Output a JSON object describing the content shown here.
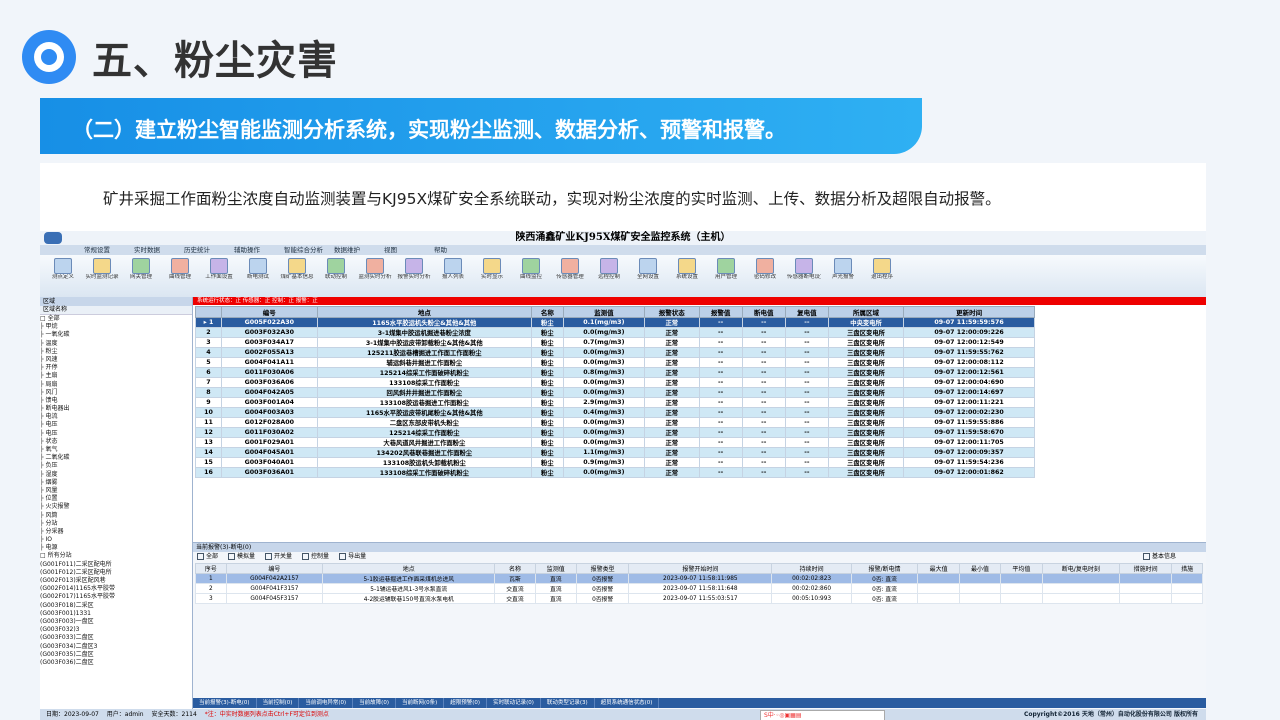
{
  "slide": {
    "title": "五、粉尘灾害",
    "banner": "（二）建立粉尘智能监测分析系统，实现粉尘监测、数据分析、预警和报警。",
    "intro": "矿井采掘工作面粉尘浓度自动监测装置与KJ95X煤矿安全系统联动，实现对粉尘浓度的实时监测、上传、数据分析及超限自动报警。"
  },
  "app": {
    "title": "陕西涌鑫矿业KJ95X煤矿安全监控系统（主机）",
    "menu": [
      "常规设置",
      "实时数据",
      "历史统计",
      "辅助操作",
      "智能综合分析",
      "数据维护",
      "视图",
      "帮助"
    ],
    "ribbon": [
      "测点定义",
      "实时监测记录",
      "网关管理",
      "曲线管理",
      "工作面设置",
      "断电测试",
      "煤矿基本信息",
      "联动控制",
      "监测实时分析",
      "报警实时分析",
      "报人列表",
      "实时显示",
      "曲线监控",
      "传感器管理",
      "远程控制",
      "全网设置",
      "系统设置",
      "用户管理",
      "密码修改",
      "传感器断电设置",
      "声光报警",
      "退出程序"
    ],
    "left_head": "区域",
    "left_subhead": "区域名称",
    "tree": [
      "□ 全部",
      "├ 甲烷",
      "├ 一氧化碳",
      "├ 温度",
      "├ 粉尘",
      "├ 风速",
      "├ 开停",
      "├ 主扇",
      "├ 局扇",
      "├ 风门",
      "├ 馈电",
      "├ 断电器出",
      "├ 电流",
      "├ 电压",
      "├ 电压",
      "├ 状态",
      "├ 氧气",
      "├ 二氧化碳",
      "├ 负压",
      "├ 湿度",
      "├ 烟雾",
      "├ 风量",
      "├ 位置",
      "├ 火灾报警",
      "├ 风筒",
      "├ 分站",
      "├ 分采器",
      "├ IO",
      "├ 电源",
      "□ 所有分站",
      "  (G001F011)二采区配电所",
      "  (G001F012)二采区配电所",
      "  (G002F013)采区配风巷",
      "  (G002F014)1165水平胶带",
      "  (G002F017)1165水平胶带",
      "  (G003F018)二采区",
      "  (G003F001)1331",
      "  (G003F003)一盘区",
      "  (G003F032)3",
      "  (G003F033)二盘区",
      "  (G003F034)二盘区3",
      "  (G003F035)二盘区",
      "  (G003F036)二盘区"
    ],
    "red_bar": "系统运行状态：正   传感器：正   控制：正   报警：正",
    "grid_headers": [
      "",
      "编号",
      "地点",
      "名称",
      "监测值",
      "报警状态",
      "报警值",
      "断电值",
      "复电值",
      "所属区域",
      "更新时间"
    ],
    "grid_rows": [
      [
        "1",
        "G005F022A30",
        "1165水平胶运机头粉尘&其他&其他",
        "粉尘",
        "0.1(mg/m3)",
        "正常",
        "--",
        "--",
        "--",
        "中央变电所",
        "09-07 11:59:59:576"
      ],
      [
        "2",
        "G003F032A30",
        "3-1煤集中胶运机掘进巷粉尘浓度",
        "粉尘",
        "0.0(mg/m3)",
        "正常",
        "--",
        "--",
        "--",
        "三盘区变电所",
        "09-07 12:00:09:226"
      ],
      [
        "3",
        "G003F034A17",
        "3-1煤集中胶运皮带卸载粉尘&其他&其他",
        "粉尘",
        "0.7(mg/m3)",
        "正常",
        "--",
        "--",
        "--",
        "三盘区变电所",
        "09-07 12:00:12:549"
      ],
      [
        "4",
        "G002F055A13",
        "125211胶运巷槽掘进工作面工作面粉尘",
        "粉尘",
        "0.0(mg/m3)",
        "正常",
        "--",
        "--",
        "--",
        "三盘区变电所",
        "09-07 11:59:55:762"
      ],
      [
        "5",
        "G004F041A11",
        "辅运斜巷井掘进工作面粉尘",
        "粉尘",
        "0.0(mg/m3)",
        "正常",
        "--",
        "--",
        "--",
        "三盘区变电所",
        "09-07 12:00:08:112"
      ],
      [
        "6",
        "G011F030A06",
        "125214综采工作面破碎机粉尘",
        "粉尘",
        "0.8(mg/m3)",
        "正常",
        "--",
        "--",
        "--",
        "三盘区变电所",
        "09-07 12:00:12:561"
      ],
      [
        "7",
        "G003F036A06",
        "133108综采工作面粉尘",
        "粉尘",
        "0.0(mg/m3)",
        "正常",
        "--",
        "--",
        "--",
        "三盘区变电所",
        "09-07 12:00:04:690"
      ],
      [
        "8",
        "G004F042A05",
        "回风斜井井掘进工作面粉尘",
        "粉尘",
        "0.0(mg/m3)",
        "正常",
        "--",
        "--",
        "--",
        "三盘区变电所",
        "09-07 12:00:14:697"
      ],
      [
        "9",
        "G003F001A04",
        "133108胶运巷掘进工作面粉尘",
        "粉尘",
        "2.9(mg/m3)",
        "正常",
        "--",
        "--",
        "--",
        "三盘区变电所",
        "09-07 12:00:11:221"
      ],
      [
        "10",
        "G004F003A03",
        "1165水平胶运皮带机尾粉尘&其他&其他",
        "粉尘",
        "0.4(mg/m3)",
        "正常",
        "--",
        "--",
        "--",
        "三盘区变电所",
        "09-07 12:00:02:230"
      ],
      [
        "11",
        "G012F028A00",
        "二盘区东部皮带机头粉尘",
        "粉尘",
        "0.0(mg/m3)",
        "正常",
        "--",
        "--",
        "--",
        "三盘区变电所",
        "09-07 11:59:55:886"
      ],
      [
        "12",
        "G011F030A02",
        "125214综采工作面粉尘",
        "粉尘",
        "0.0(mg/m3)",
        "正常",
        "--",
        "--",
        "--",
        "三盘区变电所",
        "09-07 11:59:58:670"
      ],
      [
        "13",
        "G001F029A01",
        "大巷风道风井掘进工作面粉尘",
        "粉尘",
        "0.0(mg/m3)",
        "正常",
        "--",
        "--",
        "--",
        "三盘区变电所",
        "09-07 12:00:11:705"
      ],
      [
        "14",
        "G004F045A01",
        "134202风巷联巷掘进工作面粉尘",
        "粉尘",
        "1.1(mg/m3)",
        "正常",
        "--",
        "--",
        "--",
        "三盘区变电所",
        "09-07 12:00:09:357"
      ],
      [
        "15",
        "G003F040A01",
        "133108胶运机头卸载机粉尘",
        "粉尘",
        "0.9(mg/m3)",
        "正常",
        "--",
        "--",
        "--",
        "三盘区变电所",
        "09-07 11:59:54:236"
      ],
      [
        "16",
        "G003F036A01",
        "133108综采工作面破碎机粉尘",
        "粉尘",
        "0.0(mg/m3)",
        "正常",
        "--",
        "--",
        "--",
        "三盘区变电所",
        "09-07 12:00:01:862"
      ]
    ],
    "alarm_head": "当前报警(3)-断电(0)",
    "alarm_filters": [
      "全部",
      "模拟量",
      "开关量",
      "控制量",
      "导出量"
    ],
    "alarm_basic": "基本信息",
    "alarm_headers": [
      "序号",
      "编号",
      "地点",
      "名称",
      "监测值",
      "报警类型",
      "报警开始时间",
      "持续时间",
      "报警/断电情",
      "最大值",
      "最小值",
      "平均值",
      "断电/复电时刻",
      "措施时间",
      "措施"
    ],
    "alarm_rows": [
      [
        "1",
        "G004F042A2157",
        "5-1胶运巷掘进工作面采煤机总进风",
        "瓦斯",
        "直流",
        "0否报警",
        "2023-09-07 11:58:11:985",
        "00:02:02:823",
        "0否: 直流"
      ],
      [
        "2",
        "G004F041F3157",
        "5-1辅运巷进风1-3号水泵直流",
        "交直流",
        "直流",
        "0否报警",
        "2023-09-07 11:58:11:648",
        "00:02:02:860",
        "0否: 直流"
      ],
      [
        "3",
        "G004F045F3157",
        "4-2胶运辅联巷150号直流水泵电机",
        "交直流",
        "直流",
        "0否报警",
        "2023-09-07 11:55:03:517",
        "00:05:10:993",
        "0否: 直流"
      ]
    ],
    "bottom_tabs": [
      "当前报警(3)-断电(0)",
      "当前控制(0)",
      "当前调电异常(0)",
      "当前故障(0)",
      "当前断网(0条)",
      "超限预警(0)",
      "实时联动记录(0)",
      "联动类型记录(3)",
      "超员系统通信状态(0)"
    ],
    "status": {
      "date": "日期：2023-09-07",
      "user": "用户：admin",
      "safe_days": "安全天数：2114",
      "warning": "*注：中实时数据列表点击Ctrl+F可定位到测点",
      "ime": "S中·◦◎▣▦▤",
      "copyright": "Copyright©2016 天地（常州）自动化股份有限公司 版权所有"
    }
  },
  "colors": {
    "accent": "#2f8bf3",
    "banner": "#1a96ea",
    "alarm_red": "#e00000",
    "selected_row": "#2a5ca0"
  }
}
